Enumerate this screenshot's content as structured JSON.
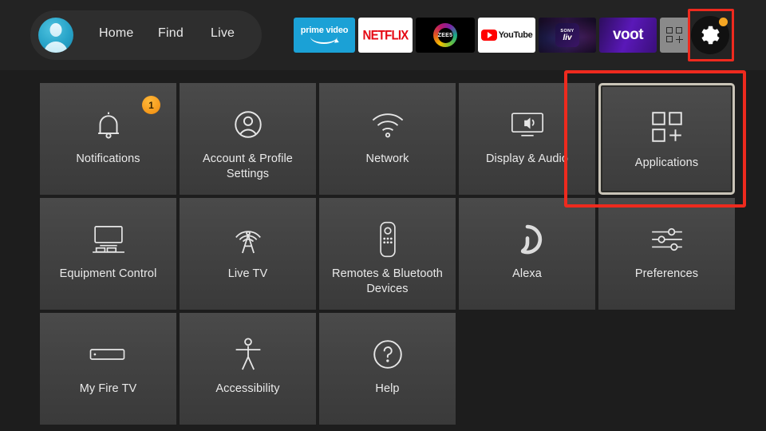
{
  "nav": {
    "avatar_name": "profile-avatar",
    "links": [
      {
        "label": "Home"
      },
      {
        "label": "Find"
      },
      {
        "label": "Live"
      }
    ],
    "apps": [
      {
        "name": "prime-video",
        "label": "prime video"
      },
      {
        "name": "netflix",
        "label": "NETFLIX"
      },
      {
        "name": "zee5",
        "label": "ZEE5"
      },
      {
        "name": "youtube",
        "label": "YouTube"
      },
      {
        "name": "sony-liv",
        "label_top": "SONY",
        "label_bottom": "liv"
      },
      {
        "name": "voot",
        "label": "voot"
      },
      {
        "name": "all-apps",
        "label": ""
      }
    ],
    "settings_button": {
      "name": "settings-gear",
      "badge": true
    }
  },
  "grid": {
    "rows": [
      [
        {
          "label": "Notifications",
          "icon": "bell-icon",
          "badge": "1",
          "focused": false
        },
        {
          "label": "Account & Profile Settings",
          "icon": "person-circle-icon",
          "focused": false
        },
        {
          "label": "Network",
          "icon": "wifi-icon",
          "focused": false
        },
        {
          "label": "Display & Audio",
          "icon": "tv-speaker-icon",
          "focused": false
        },
        {
          "label": "Applications",
          "icon": "apps-grid-plus-icon",
          "focused": true
        }
      ],
      [
        {
          "label": "Equipment Control",
          "icon": "tv-stand-icon",
          "focused": false
        },
        {
          "label": "Live TV",
          "icon": "antenna-icon",
          "focused": false
        },
        {
          "label": "Remotes & Bluetooth Devices",
          "icon": "remote-control-icon",
          "focused": false
        },
        {
          "label": "Alexa",
          "icon": "alexa-ring-icon",
          "focused": false
        },
        {
          "label": "Preferences",
          "icon": "sliders-icon",
          "focused": false
        }
      ],
      [
        {
          "label": "My Fire TV",
          "icon": "fire-tv-stick-icon",
          "focused": false
        },
        {
          "label": "Accessibility",
          "icon": "accessibility-person-icon",
          "focused": false
        },
        {
          "label": "Help",
          "icon": "question-circle-icon",
          "focused": false
        }
      ]
    ]
  },
  "highlights": {
    "gear": {
      "name": "gear-highlight-box",
      "color": "#ee2a1e"
    },
    "applications": {
      "name": "applications-highlight-box",
      "color": "#ee2a1e"
    }
  },
  "colors": {
    "background": "#1d1d1d",
    "navbar": "#232323",
    "tile": "#434343",
    "accent_orange": "#f5a623",
    "focus_border": "#c9c4b7",
    "highlight_red": "#ee2a1e"
  }
}
